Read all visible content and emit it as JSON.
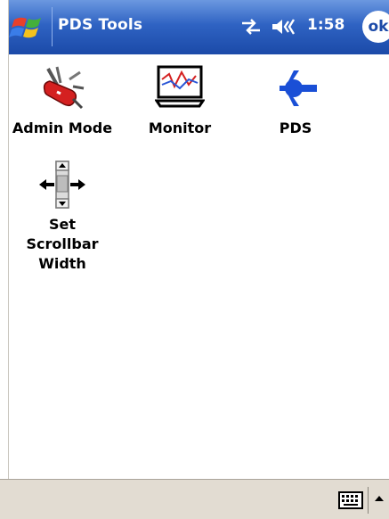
{
  "titlebar": {
    "title": "PDS Tools",
    "time": "1:58",
    "ok_label": "ok",
    "start_icon": "windows-flag-icon",
    "connectivity_icon": "connectivity-arrows-icon",
    "volume_icon": "speaker-icon"
  },
  "apps": [
    {
      "label": "Admin Mode",
      "icon": "swiss-army-knife-icon"
    },
    {
      "label": "Monitor",
      "icon": "monitor-graph-icon"
    },
    {
      "label": "PDS",
      "icon": "pds-plug-icon"
    },
    {
      "label": "Set Scrollbar Width",
      "label_lines": [
        "Set",
        "Scrollbar",
        "Width"
      ],
      "icon": "scrollbar-width-icon"
    }
  ],
  "bottombar": {
    "input_icon": "keyboard-icon",
    "input_menu_icon": "up-arrow-icon"
  },
  "colors": {
    "titlebar": "#2f63c3",
    "bottombar": "#e2dcd2",
    "pds_icon": "#1a4fd6",
    "knife_red": "#d42020"
  }
}
